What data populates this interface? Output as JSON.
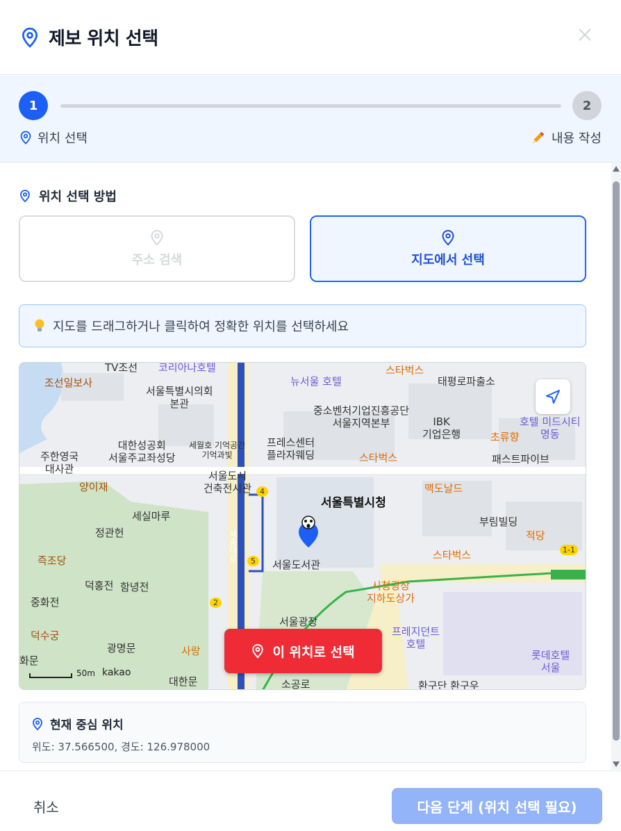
{
  "header": {
    "title": "제보 위치 선택",
    "close_icon": "close-icon"
  },
  "stepper": {
    "steps": [
      {
        "number": "1",
        "label": "위치 선택",
        "icon": "location-pin-icon",
        "active": true
      },
      {
        "number": "2",
        "label": "내용 작성",
        "icon": "pencil-icon",
        "active": false
      }
    ]
  },
  "method": {
    "title": "위치 선택 방법",
    "options": [
      {
        "label": "주소 검색",
        "selected": false
      },
      {
        "label": "지도에서 선택",
        "selected": true
      }
    ]
  },
  "hint": {
    "text": "지도를 드래그하거나 클릭하여 정확한 위치를 선택하세요",
    "icon": "lightbulb-icon"
  },
  "map": {
    "labels": {
      "tv": "TV조선",
      "koreana": "코리아나호텔",
      "chosun": "조선일보사",
      "newseoul": "뉴서울 호텔",
      "starbucks": "스타벅스",
      "taepyeong": "태평로파출소",
      "council": "서울특별시의회",
      "council2": "본관",
      "sme": "중소벤처기업진흥공단",
      "sme2": "서울지역본부",
      "ibk": "IBK",
      "ibk2": "기업은행",
      "hotel_mid": "호텔 미드시티",
      "hotel_mid2": "명동",
      "chouryu": "초류향",
      "anglican": "대한성공회",
      "anglican2": "서울주교좌성당",
      "sewol": "세월호 기억공간",
      "sewol2": "기억과빛",
      "press": "프레스센터",
      "press2": "플라자웨딩",
      "starbucks2": "스타벅스",
      "uk": "주한영국",
      "uk2": "대사관",
      "yangijae": "양이재",
      "archive": "서울도시",
      "archive2": "건축전시관",
      "cityhall": "서울특별시청",
      "mcd": "맥도날드",
      "fastfive": "패스트파이브",
      "sesil": "세실마루",
      "jeonggwan": "정관헌",
      "burim": "부림빌딩",
      "jeokdang": "적당",
      "jukjodang": "즉조당",
      "library": "서울도서관",
      "starbucks3": "스타벅스",
      "deokhong": "덕홍전",
      "hamnyeong": "함녕전",
      "station": "시청광장",
      "station2": "지하도상가",
      "junghwa": "중화전",
      "plaza": "서울광장",
      "president": "프레지던트",
      "president2": "호텔",
      "lotte": "롯데호텔",
      "lotte2": "서울",
      "deoksu": "덕수궁",
      "sarang": "사랑",
      "gwangmyeong": "광명문",
      "daehanmun": "대한문",
      "hwamun": "화문",
      "sogongro": "소공로",
      "hwangudan": "환구단 환구우",
      "sejong": "세종대로",
      "line_1": "1-1",
      "bus_4": "4",
      "bus_5": "5",
      "bus_2": "2"
    },
    "scale_label": "50m",
    "provider": "kakao",
    "select_button": "이 위치로 선택",
    "locate_icon": "navigation-arrow-icon"
  },
  "current": {
    "title": "현재 중심 위치",
    "coords": "위도: 37.566500, 경도: 126.978000"
  },
  "footer": {
    "cancel": "취소",
    "next": "다음 단계 (위치 선택 필요)"
  },
  "colors": {
    "primary": "#1d5ff5",
    "danger": "#ef2b36",
    "disabled": "#93b4f8"
  }
}
